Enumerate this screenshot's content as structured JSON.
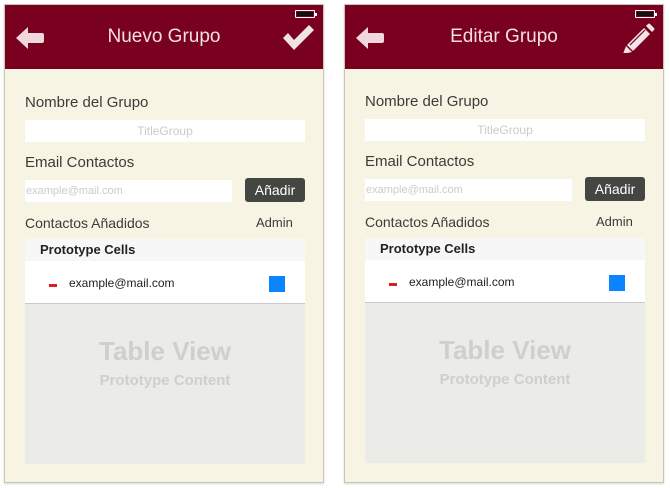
{
  "screens": [
    {
      "title": "Nuevo Grupo",
      "back_icon": "back-arrow-icon",
      "action_icon": "checkmark-icon",
      "group_name_label": "Nombre del Grupo",
      "group_name_placeholder": "TitleGroup",
      "email_label": "Email Contactos",
      "email_placeholder": "example@mail.com",
      "add_button": "Añadir",
      "added_contacts_label": "Contactos Añadidos",
      "admin_label": "Admin",
      "table": {
        "section_header": "Prototype Cells",
        "cell_text": "example@mail.com",
        "placeholder_title": "Table View",
        "placeholder_subtitle": "Prototype Content"
      }
    },
    {
      "title": "Editar Grupo",
      "back_icon": "back-arrow-icon",
      "action_icon": "pencil-icon",
      "group_name_label": "Nombre del Grupo",
      "group_name_placeholder": "TitleGroup",
      "email_label": "Email Contactos",
      "email_placeholder": "example@mail.com",
      "add_button": "Añadir",
      "added_contacts_label": "Contactos Añadidos",
      "admin_label": "Admin",
      "table": {
        "section_header": "Prototype Cells",
        "cell_text": "example@mail.com",
        "placeholder_title": "Table View",
        "placeholder_subtitle": "Prototype Content"
      }
    }
  ],
  "colors": {
    "navbar": "#7a0020",
    "background": "#f8f4e3",
    "button": "#444642",
    "accent_blue": "#0a84ff",
    "delete_red": "#e21b1b"
  }
}
